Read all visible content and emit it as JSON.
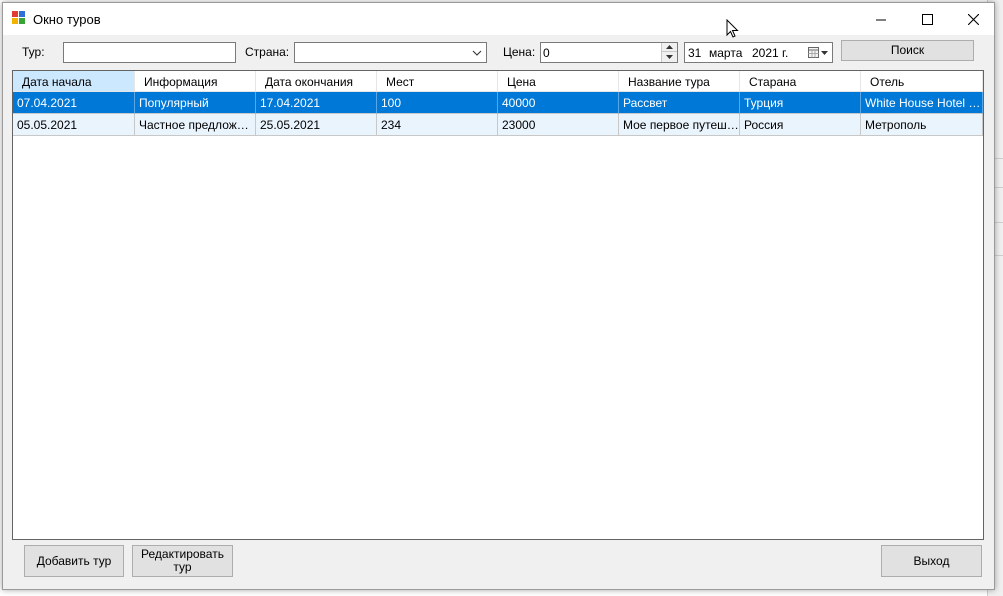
{
  "window": {
    "title": "Окно туров"
  },
  "filters": {
    "tour_label": "Тур:",
    "tour_value": "",
    "country_label": "Страна:",
    "country_value": "",
    "price_label": "Цена:",
    "price_value": "0",
    "date": {
      "day": "31",
      "month": "марта",
      "year": "2021 г."
    },
    "search_button": "Поиск"
  },
  "table": {
    "columns": [
      "Дата начала",
      "Информация",
      "Дата окончания",
      "Мест",
      "Цена",
      "Название тура",
      "Старана",
      "Отель"
    ],
    "rows": [
      [
        "07.04.2021",
        "Популярный",
        "17.04.2021",
        "100",
        "40000",
        "Рассвет",
        "Турция",
        "White House Hotel Istanbul"
      ],
      [
        "05.05.2021",
        "Частное предложение",
        "25.05.2021",
        "234",
        "23000",
        "Мое первое путешествие",
        "Россия",
        "Метрополь"
      ]
    ],
    "selected_row": 0
  },
  "buttons": {
    "add": "Добавить тур",
    "edit_line1": "Редактировать",
    "edit_line2": "тур",
    "exit": "Выход"
  },
  "colors": {
    "selection": "#0078d7",
    "header_active": "#cce8ff",
    "alt_row": "#eaf4fd"
  }
}
